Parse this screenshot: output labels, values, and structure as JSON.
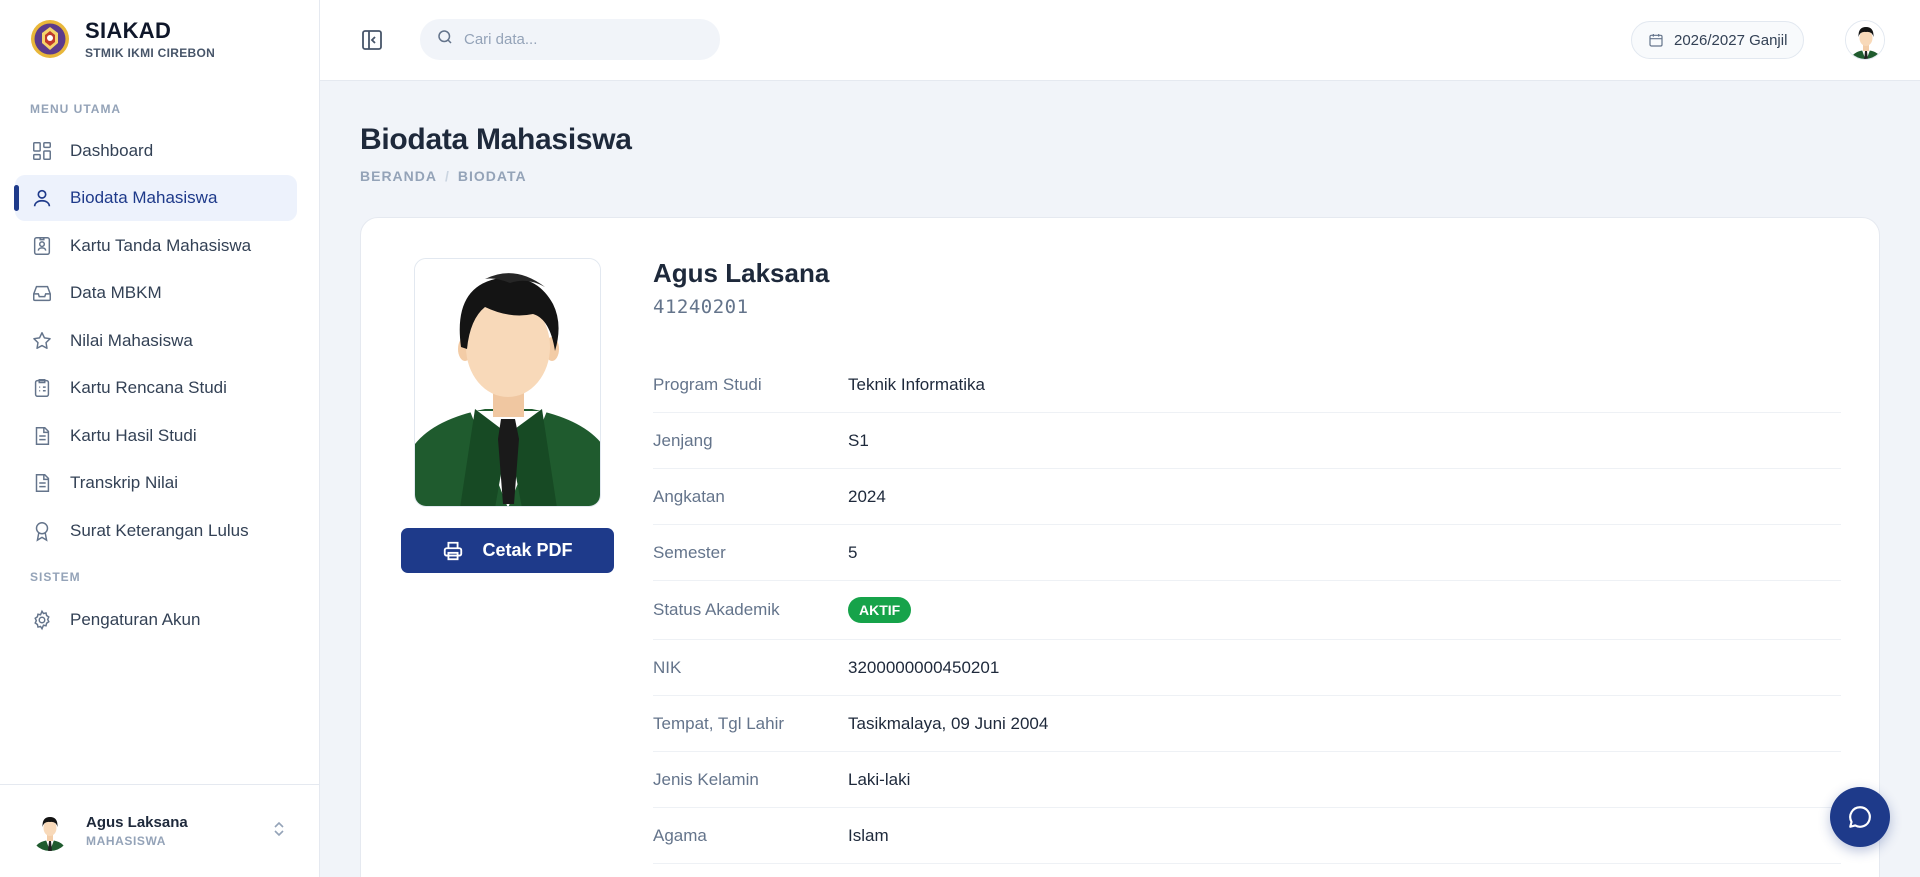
{
  "brand": {
    "title": "SIAKAD",
    "subtitle": "STMIK IKMI CIREBON"
  },
  "sidebar": {
    "section_main": "MENU UTAMA",
    "section_system": "SISTEM",
    "items": [
      {
        "label": "Dashboard",
        "icon": "dashboard-icon"
      },
      {
        "label": "Biodata Mahasiswa",
        "icon": "user-icon",
        "active": true
      },
      {
        "label": "Kartu Tanda Mahasiswa",
        "icon": "id-card-icon"
      },
      {
        "label": "Data MBKM",
        "icon": "inbox-icon"
      },
      {
        "label": "Nilai Mahasiswa",
        "icon": "star-icon"
      },
      {
        "label": "Kartu Rencana Studi",
        "icon": "clipboard-icon"
      },
      {
        "label": "Kartu Hasil Studi",
        "icon": "document-icon"
      },
      {
        "label": "Transkrip Nilai",
        "icon": "document-icon"
      },
      {
        "label": "Surat Keterangan Lulus",
        "icon": "award-icon"
      }
    ],
    "system_items": [
      {
        "label": "Pengaturan Akun",
        "icon": "gear-icon"
      }
    ],
    "footer": {
      "name": "Agus Laksana",
      "role": "MAHASISWA"
    }
  },
  "header": {
    "search_placeholder": "Cari data...",
    "period": "2026/2027 Ganjil"
  },
  "page": {
    "title": "Biodata Mahasiswa",
    "breadcrumb": [
      "BERANDA",
      "BIODATA"
    ]
  },
  "profile": {
    "name": "Agus Laksana",
    "nim": "41240201",
    "print_label": "Cetak PDF",
    "fields": [
      {
        "label": "Program Studi",
        "value": "Teknik Informatika"
      },
      {
        "label": "Jenjang",
        "value": "S1"
      },
      {
        "label": "Angkatan",
        "value": "2024"
      },
      {
        "label": "Semester",
        "value": "5"
      },
      {
        "label": "Status Akademik",
        "value": "AKTIF",
        "badge": true,
        "badge_color": "#16a34a"
      },
      {
        "label": "NIK",
        "value": "3200000000450201"
      },
      {
        "label": "Tempat, Tgl Lahir",
        "value": "Tasikmalaya, 09 Juni 2004"
      },
      {
        "label": "Jenis Kelamin",
        "value": "Laki-laki"
      },
      {
        "label": "Agama",
        "value": "Islam"
      }
    ]
  },
  "colors": {
    "primary": "#1e3a8a",
    "success": "#16a34a",
    "background": "#f1f4f9"
  }
}
